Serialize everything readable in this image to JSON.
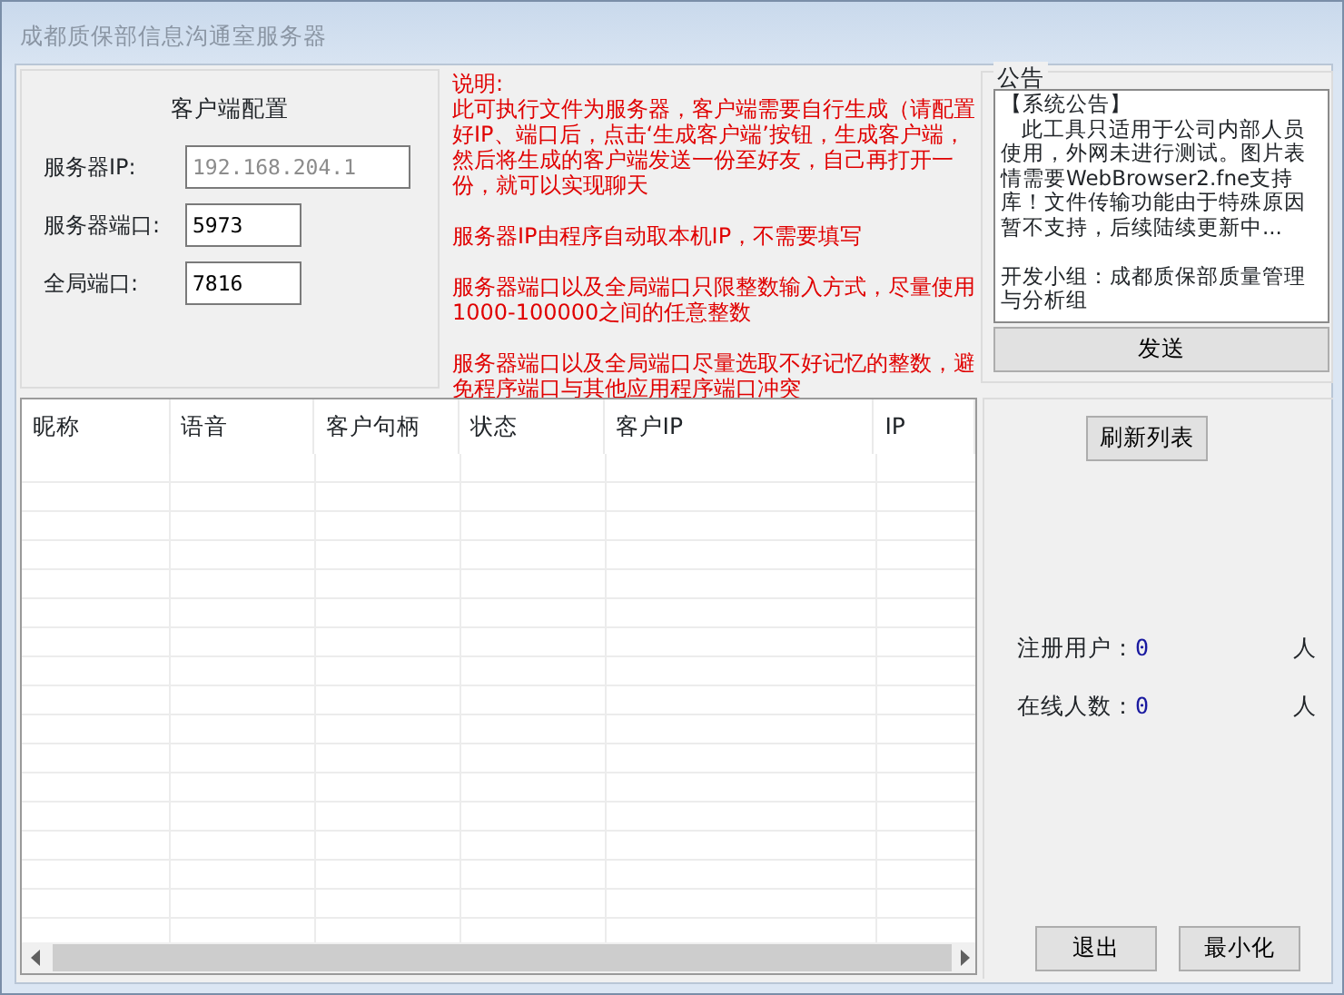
{
  "window": {
    "title": "成都质保部信息沟通室服务器"
  },
  "config": {
    "title": "客户端配置",
    "fields": [
      {
        "label": "服务器IP:",
        "value": "192.168.204.1",
        "disabled": true
      },
      {
        "label": "服务器端口:",
        "value": "5973",
        "disabled": false
      },
      {
        "label": "全局端口:",
        "value": "7816",
        "disabled": false
      }
    ]
  },
  "notes": {
    "heading": "说明:",
    "paragraphs": [
      "此可执行文件为服务器，客户端需要自行生成（请配置好IP、端口后，点击‘生成客户端’按钮，生成客户端，然后将生成的客户端发送一份至好友，自己再打开一份，就可以实现聊天",
      "服务器IP由程序自动取本机IP，不需要填写",
      "服务器端口以及全局端口只限整数输入方式，尽量使用1000-100000之间的任意整数",
      "服务器端口以及全局端口尽量选取不好记忆的整数，避免程序端口与其他应用程序端口冲突"
    ]
  },
  "announcement": {
    "title": "公告",
    "lines": [
      "【系统公告】",
      "此工具只适用于公司内部人员使用，外网未进行测试。图片表情需要WebBrowser2.fne支持库！文件传输功能由于特殊原因暂不支持，后续陆续更新中...",
      "开发小组：成都质保部质量管理与分析组"
    ],
    "button": "发送"
  },
  "table": {
    "columns": [
      "昵称",
      "语音",
      "客户句柄",
      "状态",
      "客户IP",
      "IP"
    ]
  },
  "side": {
    "refresh_button": "刷新列表",
    "stats": [
      {
        "label": "注册用户：",
        "value": "0",
        "unit": "人"
      },
      {
        "label": "在线人数：",
        "value": "0",
        "unit": "人"
      }
    ],
    "buttons": [
      "退出",
      "最小化"
    ]
  }
}
